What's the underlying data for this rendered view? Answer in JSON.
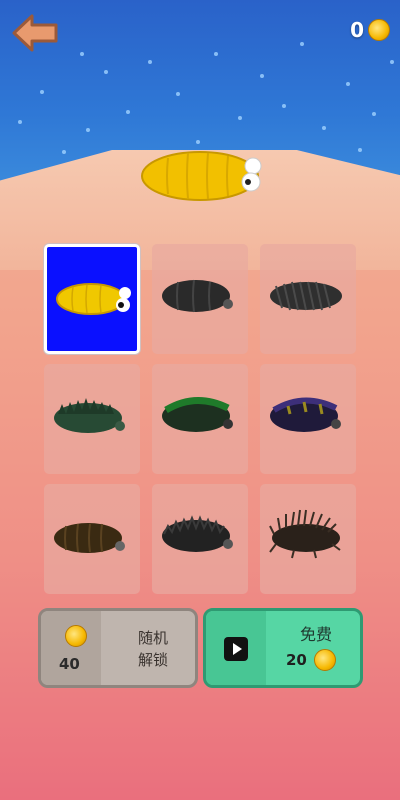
{
  "hud": {
    "coins": "0"
  },
  "grid": {
    "items": [
      {
        "name": "yellow-worm",
        "color": "#f0c800",
        "selected": true
      },
      {
        "name": "black-worm",
        "color": "#2a2a2a"
      },
      {
        "name": "striped-black-worm",
        "color": "#2f2f2f"
      },
      {
        "name": "spiky-green-worm",
        "color": "#274a34"
      },
      {
        "name": "green-worm",
        "color": "#0f4d20"
      },
      {
        "name": "purple-worm",
        "color": "#2a1f4f"
      },
      {
        "name": "brown-worm",
        "color": "#3a2a12"
      },
      {
        "name": "fuzzy-black-worm",
        "color": "#222222"
      },
      {
        "name": "hairy-brown-worm",
        "color": "#3a2a20"
      }
    ]
  },
  "buttons": {
    "random_unlock_label": "随机\n解锁",
    "random_unlock_price": "40",
    "free_label": "免费",
    "free_price": "20"
  },
  "icons": {
    "back": "back-arrow-icon",
    "coin": "coin-icon",
    "play": "video-play-icon"
  }
}
